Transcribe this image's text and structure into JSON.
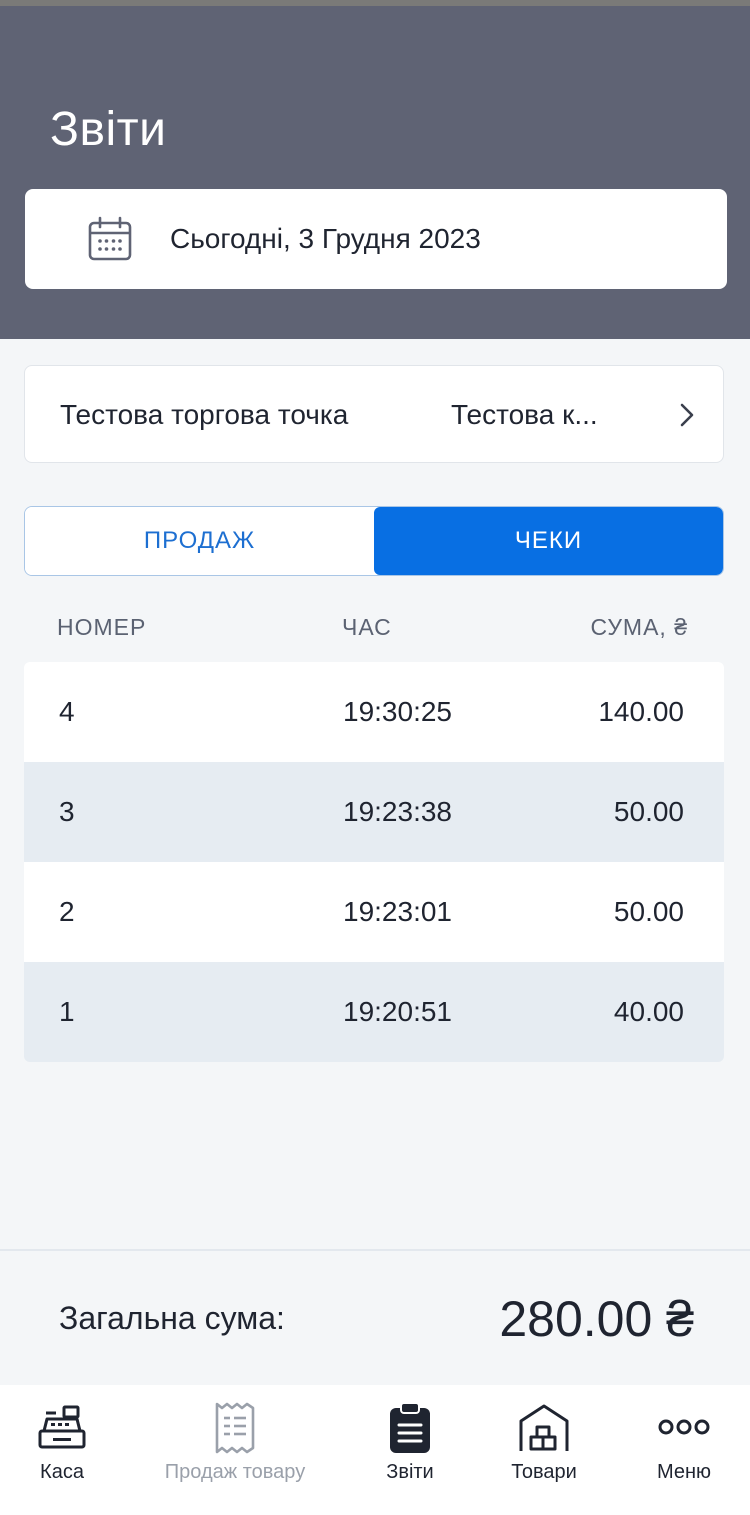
{
  "header": {
    "title": "Звіти"
  },
  "date_picker": {
    "icon": "calendar-icon",
    "label": "Сьогодні, 3 Грудня 2023"
  },
  "store_selector": {
    "store": "Тестова торгова точка",
    "register": "Тестова к...",
    "icon": "chevron-right-icon"
  },
  "tabs": [
    {
      "label": "ПРОДАЖ",
      "active": false
    },
    {
      "label": "ЧЕКИ",
      "active": true
    }
  ],
  "table": {
    "columns": [
      "НОМЕР",
      "ЧАС",
      "СУМА, ₴"
    ],
    "rows": [
      {
        "num": "4",
        "time": "19:30:25",
        "sum": "140.00"
      },
      {
        "num": "3",
        "time": "19:23:38",
        "sum": "50.00"
      },
      {
        "num": "2",
        "time": "19:23:01",
        "sum": "50.00"
      },
      {
        "num": "1",
        "time": "19:20:51",
        "sum": "40.00"
      }
    ]
  },
  "total": {
    "label": "Загальна сума:",
    "value": "280.00 ₴"
  },
  "nav": [
    {
      "label": "Каса",
      "icon": "cash-register-icon",
      "active": false
    },
    {
      "label": "Продаж товару",
      "icon": "receipt-icon",
      "active": false
    },
    {
      "label": "Звіти",
      "icon": "clipboard-icon",
      "active": true
    },
    {
      "label": "Товари",
      "icon": "warehouse-icon",
      "active": false
    },
    {
      "label": "Меню",
      "icon": "more-dots-icon",
      "active": false
    }
  ],
  "colors": {
    "header_bg": "#5f6374",
    "accent": "#086fe3",
    "row_alt": "#e6ecf2"
  }
}
